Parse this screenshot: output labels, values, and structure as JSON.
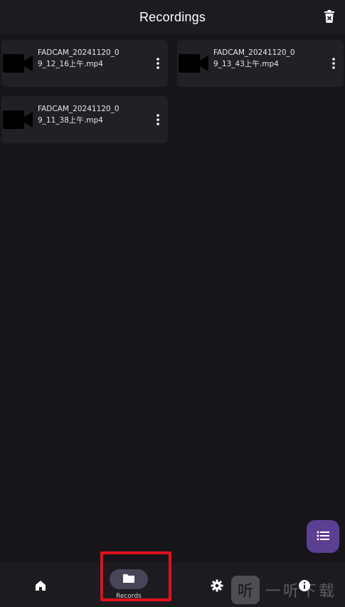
{
  "header": {
    "title": "Recordings",
    "delete_icon": "trash-icon"
  },
  "recordings": [
    {
      "filename": "FADCAM_20241120_09_12_16上午.mp4",
      "thumb_icon": "video-camera-icon"
    },
    {
      "filename": "FADCAM_20241120_09_13_43上午.mp4",
      "thumb_icon": "video-camera-icon"
    },
    {
      "filename": "FADCAM_20241120_09_11_38上午.mp4",
      "thumb_icon": "video-camera-icon"
    }
  ],
  "fab": {
    "icon": "list-icon"
  },
  "bottom_nav": {
    "items": [
      {
        "id": "home",
        "icon": "home-icon"
      },
      {
        "id": "records",
        "icon": "folder-icon",
        "label": "Records",
        "selected": true
      },
      {
        "id": "settings",
        "icon": "gear-icon"
      },
      {
        "id": "about",
        "icon": "info-icon"
      }
    ]
  },
  "watermark": {
    "glyph": "听",
    "text": "一听下载"
  },
  "colors": {
    "background": "#17151a",
    "surface": "#1d1b20",
    "card": "#222025",
    "fab": "#5b3f93",
    "nav_pill": "#4a4458",
    "highlight": "#e0101d"
  }
}
